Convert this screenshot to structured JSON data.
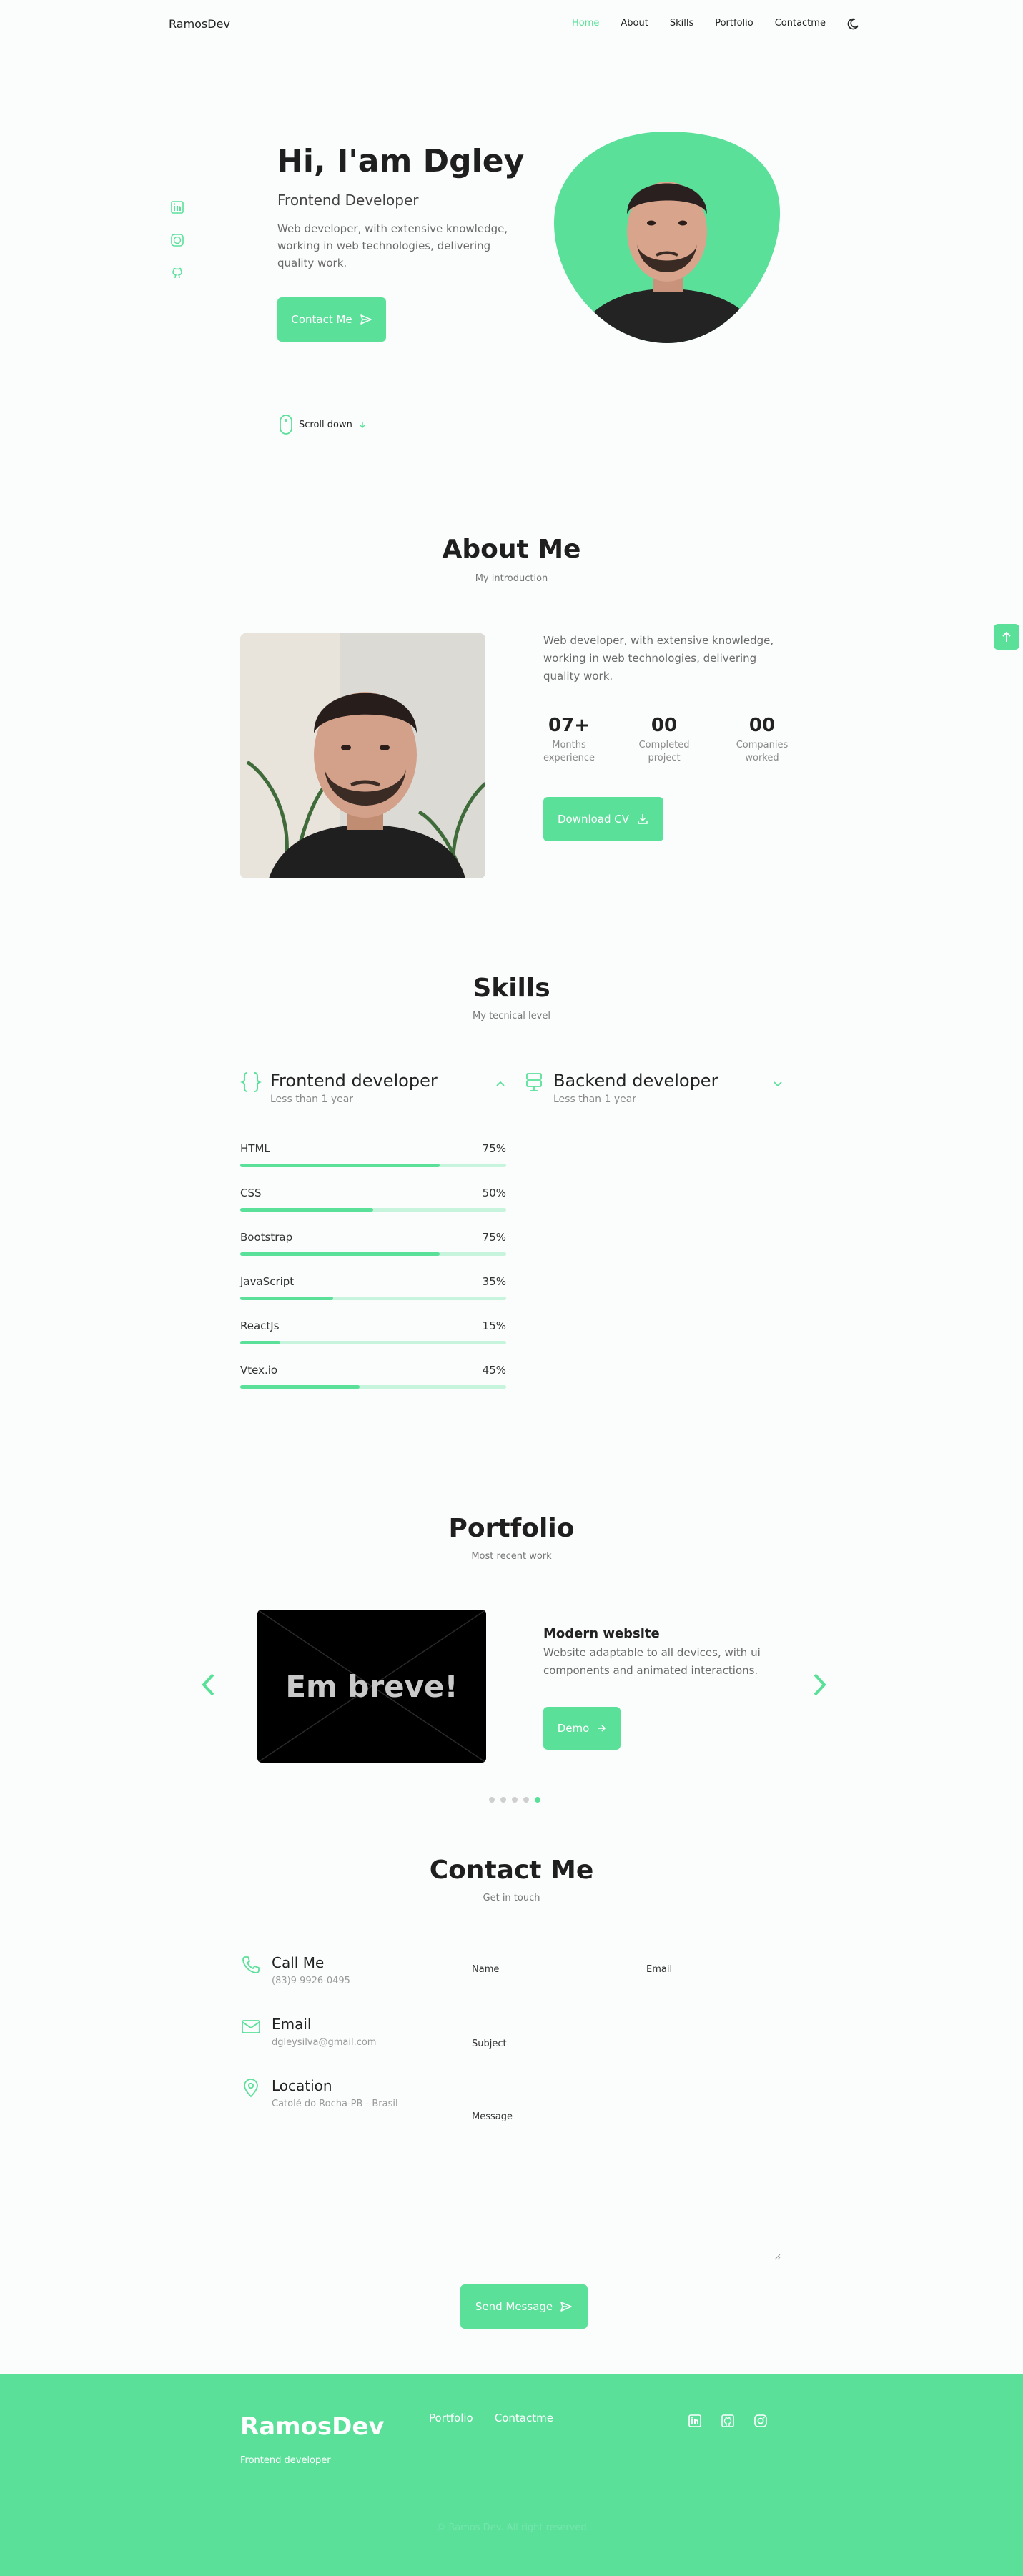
{
  "header": {
    "logo": "RamosDev",
    "nav": [
      "Home",
      "About",
      "Skills",
      "Portfolio",
      "Contactme"
    ],
    "active": "Home"
  },
  "hero": {
    "title": "Hi, I'am Dgley",
    "subtitle": "Frontend Developer",
    "description": "Web developer, with extensive knowledge, working in web technologies, delivering quality work.",
    "cta": "Contact Me",
    "scroll": "Scroll down",
    "social": [
      "linkedin-icon",
      "dribbble-icon",
      "github-icon"
    ]
  },
  "about": {
    "title": "About Me",
    "subtitle": "My introduction",
    "description": "Web developer, with extensive knowledge, working in web technologies, delivering quality work.",
    "stats": [
      {
        "num": "07+",
        "line1": "Months",
        "line2": "experience"
      },
      {
        "num": "00",
        "line1": "Completed",
        "line2": "project"
      },
      {
        "num": "00",
        "line1": "Companies",
        "line2": "worked"
      }
    ],
    "download": "Download CV"
  },
  "skills": {
    "title": "Skills",
    "subtitle": "My tecnical level",
    "frontend": {
      "title": "Frontend developer",
      "subtitle": "Less than 1 year"
    },
    "backend": {
      "title": "Backend developer",
      "subtitle": "Less than 1 year"
    },
    "items": [
      {
        "name": "HTML",
        "percent": "75%",
        "value": 75
      },
      {
        "name": "CSS",
        "percent": "50%",
        "value": 50
      },
      {
        "name": "Bootstrap",
        "percent": "75%",
        "value": 75
      },
      {
        "name": "JavaScript",
        "percent": "35%",
        "value": 35
      },
      {
        "name": "ReactJs",
        "percent": "15%",
        "value": 15
      },
      {
        "name": "Vtex.io",
        "percent": "45%",
        "value": 45
      }
    ]
  },
  "portfolio": {
    "title": "Portfolio",
    "subtitle": "Most recent work",
    "image_text": "Em breve!",
    "project_title": "Modern website",
    "project_desc": "Website adaptable to all devices, with ui components and animated interactions.",
    "demo": "Demo",
    "slides": 5,
    "active_slide": 5
  },
  "contact": {
    "title": "Contact Me",
    "subtitle": "Get in touch",
    "call": {
      "title": "Call Me",
      "value": "(83)9 9926-0495"
    },
    "email": {
      "title": "Email",
      "value": "dgleysilva@gmail.com"
    },
    "location": {
      "title": "Location",
      "value": "Catolé do Rocha-PB - Brasil"
    },
    "fields": {
      "name": "Name",
      "email": "Email",
      "subject": "Subject",
      "message": "Message"
    },
    "send": "Send Message"
  },
  "footer": {
    "logo": "RamosDev",
    "subtitle": "Frontend developer",
    "links": [
      "Portfolio",
      "Contactme"
    ],
    "copyright": "© Ramos Dev. All right reserved"
  },
  "colors": {
    "accent": "#5be09a",
    "text": "#222222"
  }
}
